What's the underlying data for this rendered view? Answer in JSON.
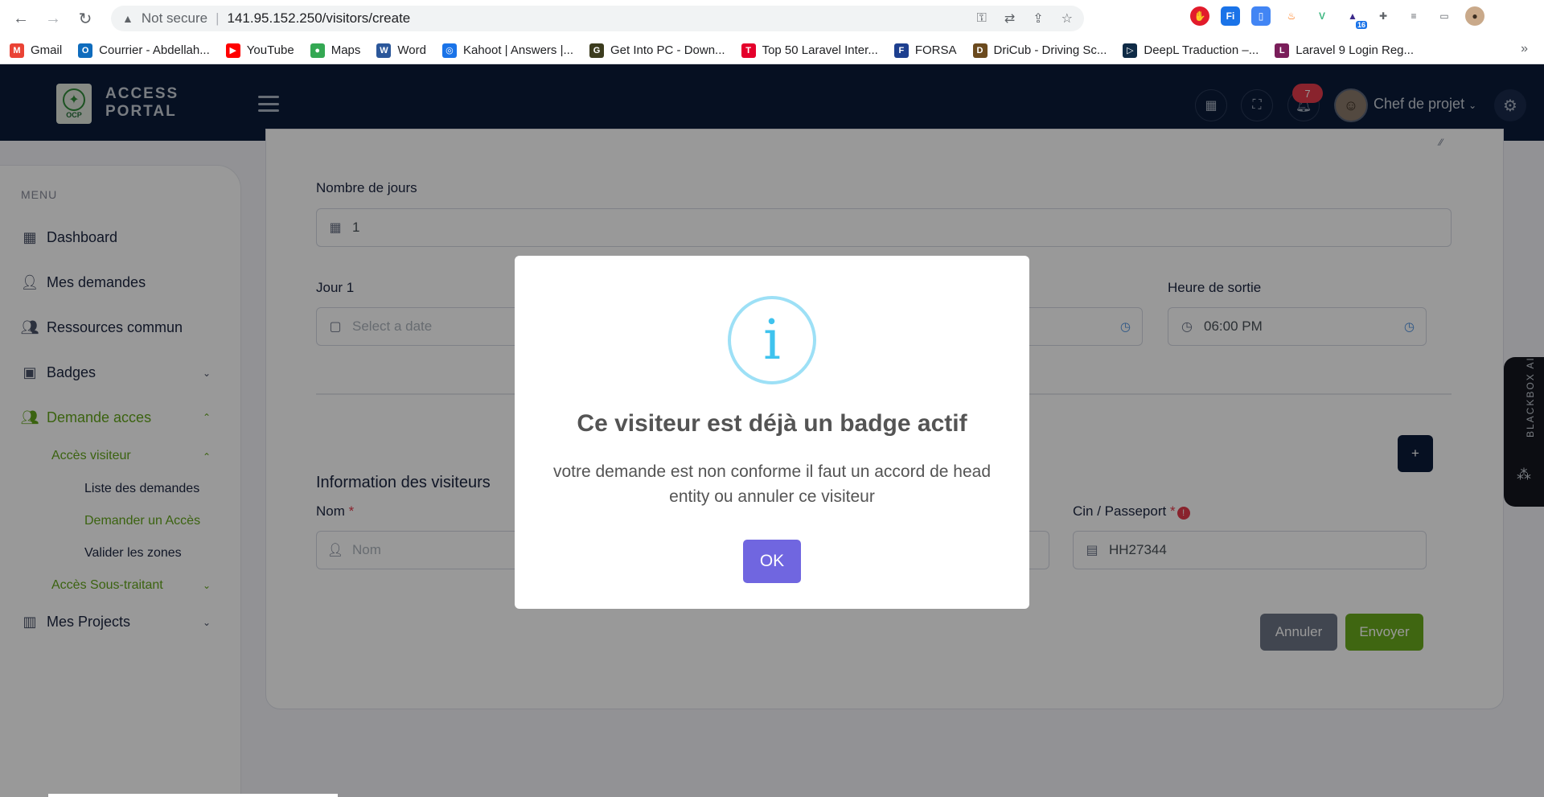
{
  "browser": {
    "not_secure": "Not secure",
    "url": "141.95.152.250/visitors/create",
    "bookmarks": [
      {
        "label": "Gmail",
        "color": "#ea4335",
        "glyph": "M"
      },
      {
        "label": "Courrier - Abdellah...",
        "color": "#0f6cbd",
        "glyph": "O"
      },
      {
        "label": "YouTube",
        "color": "#ff0000",
        "glyph": "▶"
      },
      {
        "label": "Maps",
        "color": "#34a853",
        "glyph": "●"
      },
      {
        "label": "Word",
        "color": "#2b579a",
        "glyph": "W"
      },
      {
        "label": "Kahoot | Answers |...",
        "color": "#1a73e8",
        "glyph": "◎"
      },
      {
        "label": "Get Into PC - Down...",
        "color": "#3c3c1e",
        "glyph": "G"
      },
      {
        "label": "Top 50 Laravel Inter...",
        "color": "#e4002b",
        "glyph": "T"
      },
      {
        "label": "FORSA",
        "color": "#1d3f8f",
        "glyph": "F"
      },
      {
        "label": "DriCub - Driving Sc...",
        "color": "#6b4a1e",
        "glyph": "D"
      },
      {
        "label": "DeepL Traduction –...",
        "color": "#0f2b46",
        "glyph": "▷"
      },
      {
        "label": "Laravel 9 Login Reg...",
        "color": "#7a1e5a",
        "glyph": "L"
      }
    ],
    "more": "»"
  },
  "header": {
    "brand_line1": "ACCESS",
    "brand_line2": "PORTAL",
    "logo_text": "OCP",
    "notification_count": "7",
    "user_name": "Chef de projet"
  },
  "sidebar": {
    "menu_title": "MENU",
    "items": {
      "dashboard": "Dashboard",
      "mes_demandes": "Mes demandes",
      "ressources": "Ressources commun",
      "badges": "Badges",
      "demande_acces": "Demande acces",
      "acces_visiteur": "Accès visiteur",
      "liste_demandes": "Liste des demandes",
      "demander_acces": "Demander un Accès",
      "valider_zones": "Valider les zones",
      "acces_sous_traitant": "Accès Sous-traitant",
      "mes_projects": "Mes Projects"
    }
  },
  "form": {
    "nombre_jours_label": "Nombre de jours",
    "nombre_jours_value": "1",
    "jour1_label": "Jour 1",
    "jour1_placeholder": "Select a date",
    "heure_sortie_label": "Heure de sortie",
    "heure_sortie_value": "06:00 PM",
    "section_title": "Information des visiteurs",
    "plus_label": "+",
    "nom_label": "Nom",
    "nom_placeholder": "Nom",
    "cin_label": "Cin / Passeport",
    "cin_value": "HH27344",
    "required_mark": "*",
    "cancel_label": "Annuler",
    "send_label": "Envoyer"
  },
  "blackbox": {
    "label": "BLACKBOX AI"
  },
  "modal": {
    "title": "Ce visiteur est déjà un badge actif",
    "text": "votre demande est non conforme il faut un accord de head entity ou annuler ce visiteur",
    "ok_label": "OK",
    "icon_glyph": "i"
  }
}
